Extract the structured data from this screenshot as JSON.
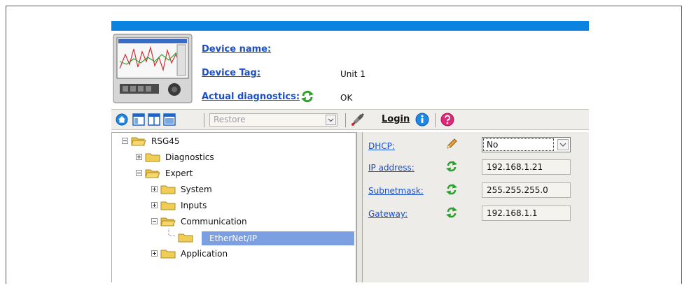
{
  "header": {
    "device_name_label": "Device name:",
    "device_name_value": "",
    "device_tag_label": "Device Tag:",
    "device_tag_value": "Unit 1",
    "diagnostics_label": "Actual diagnostics:",
    "diagnostics_value": "OK"
  },
  "toolbar": {
    "restore_label": "Restore",
    "login_label": "Login"
  },
  "tree": {
    "root": "RSG45",
    "items": [
      "Diagnostics",
      "Expert",
      "System",
      "Inputs",
      "Communication",
      "EtherNet/IP",
      "Application"
    ]
  },
  "properties": [
    {
      "label": "DHCP:",
      "value": "No",
      "icon": "pencil-icon"
    },
    {
      "label": "IP address:",
      "value": "192.168.1.21",
      "icon": "refresh-icon"
    },
    {
      "label": "Subnetmask:",
      "value": "255.255.255.0",
      "icon": "refresh-icon"
    },
    {
      "label": "Gateway:",
      "value": "192.168.1.1",
      "icon": "refresh-icon"
    }
  ],
  "colors": {
    "topbar": "#0a84e0",
    "link": "#1a4fc9",
    "selection": "#7b9fe0"
  }
}
